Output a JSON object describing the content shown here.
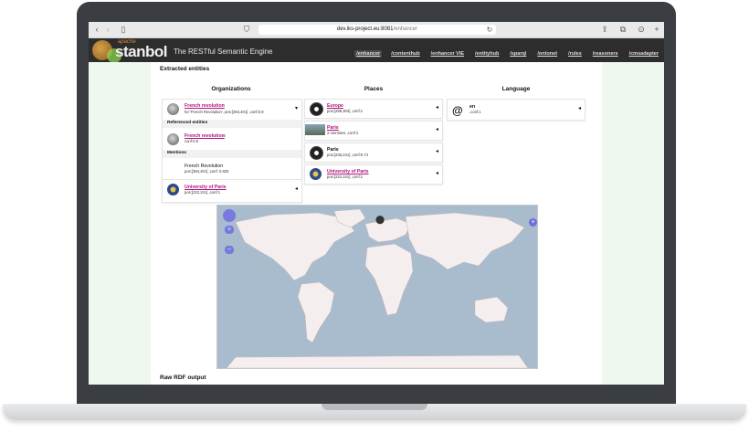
{
  "browser": {
    "url_host": "dev.iks-project.eu:8081",
    "url_path": "/enhancer",
    "back_glyph": "‹",
    "forward_glyph": "›",
    "sidebar_glyph": "▯",
    "shield_glyph": "⛉",
    "reload_glyph": "↻",
    "share_glyph": "⇪",
    "tabs_glyph": "⧉",
    "download_glyph": "⊙",
    "plus_glyph": "+"
  },
  "header": {
    "logo_apache": "apache",
    "logo_name": "stanbol",
    "tagline": "The RESTful Semantic Engine",
    "nav": [
      "/enhancer",
      "/contenthub",
      "/enhancer VIE",
      "/entityhub",
      "/sparql",
      "/ontonet",
      "/rules",
      "/reasoners",
      "/cmsadapter"
    ],
    "active_nav": "/enhancer"
  },
  "main": {
    "extracted_title": "Extracted entities",
    "raw_rdf_title": "Raw RDF output",
    "columns": {
      "organizations": "Organizations",
      "places": "Places",
      "language": "Language"
    },
    "organizations": {
      "main": {
        "title": "French revolution",
        "subtitle": "for:'French Revolution', pos:[384,401] ,conf:0.8"
      },
      "referenced_header": "Referenced entities",
      "referenced": {
        "title": "French revolution",
        "ext_glyph": "⧉",
        "subtitle": "conf:0.8"
      },
      "mentions_header": "Mentions",
      "mention": {
        "title": "French Revolution",
        "subtitle": "pos:[384,401] ,conf: 0.825"
      },
      "second": {
        "title": "University of Paris",
        "subtitle": "pos:[222,241] ,conf:1"
      }
    },
    "places": [
      {
        "title": "Europe",
        "subtitle": "pos:[298,304] ,conf:1",
        "linked": true
      },
      {
        "title": "Paris",
        "subtitle": "2 mentions ,conf:1",
        "linked": true
      },
      {
        "title": "Paris",
        "subtitle": "pos:[236,241] ,conf:0.74",
        "linked": false
      },
      {
        "title": "University of Paris",
        "subtitle": "pos:[222,241] ,conf:1",
        "linked": true
      }
    ],
    "language": {
      "title": "en",
      "subtitle": ",conf:1",
      "icon_glyph": "@"
    },
    "arrows": {
      "collapse": "◂",
      "expand": "▾"
    },
    "map": {
      "marker_glyph": "⬤",
      "zoom_in": "+",
      "zoom_out": "−",
      "layer_switcher": "+"
    }
  },
  "colors": {
    "link": "#b0117f",
    "header_bg": "#2d2d2d",
    "side_bg": "#eef8ee",
    "ocean": "#a8bccd",
    "land": "#f5eeee"
  }
}
